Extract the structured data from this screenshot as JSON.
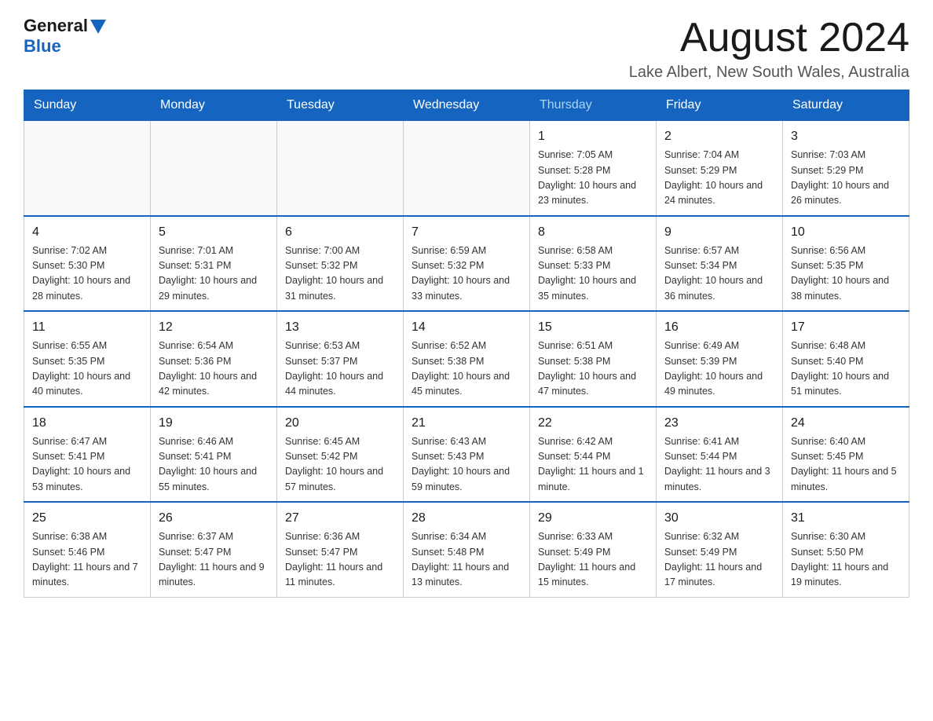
{
  "header": {
    "logo_general": "General",
    "logo_blue": "Blue",
    "month_year": "August 2024",
    "location": "Lake Albert, New South Wales, Australia"
  },
  "weekdays": [
    "Sunday",
    "Monday",
    "Tuesday",
    "Wednesday",
    "Thursday",
    "Friday",
    "Saturday"
  ],
  "weeks": [
    [
      {
        "day": "",
        "info": ""
      },
      {
        "day": "",
        "info": ""
      },
      {
        "day": "",
        "info": ""
      },
      {
        "day": "",
        "info": ""
      },
      {
        "day": "1",
        "info": "Sunrise: 7:05 AM\nSunset: 5:28 PM\nDaylight: 10 hours\nand 23 minutes."
      },
      {
        "day": "2",
        "info": "Sunrise: 7:04 AM\nSunset: 5:29 PM\nDaylight: 10 hours\nand 24 minutes."
      },
      {
        "day": "3",
        "info": "Sunrise: 7:03 AM\nSunset: 5:29 PM\nDaylight: 10 hours\nand 26 minutes."
      }
    ],
    [
      {
        "day": "4",
        "info": "Sunrise: 7:02 AM\nSunset: 5:30 PM\nDaylight: 10 hours\nand 28 minutes."
      },
      {
        "day": "5",
        "info": "Sunrise: 7:01 AM\nSunset: 5:31 PM\nDaylight: 10 hours\nand 29 minutes."
      },
      {
        "day": "6",
        "info": "Sunrise: 7:00 AM\nSunset: 5:32 PM\nDaylight: 10 hours\nand 31 minutes."
      },
      {
        "day": "7",
        "info": "Sunrise: 6:59 AM\nSunset: 5:32 PM\nDaylight: 10 hours\nand 33 minutes."
      },
      {
        "day": "8",
        "info": "Sunrise: 6:58 AM\nSunset: 5:33 PM\nDaylight: 10 hours\nand 35 minutes."
      },
      {
        "day": "9",
        "info": "Sunrise: 6:57 AM\nSunset: 5:34 PM\nDaylight: 10 hours\nand 36 minutes."
      },
      {
        "day": "10",
        "info": "Sunrise: 6:56 AM\nSunset: 5:35 PM\nDaylight: 10 hours\nand 38 minutes."
      }
    ],
    [
      {
        "day": "11",
        "info": "Sunrise: 6:55 AM\nSunset: 5:35 PM\nDaylight: 10 hours\nand 40 minutes."
      },
      {
        "day": "12",
        "info": "Sunrise: 6:54 AM\nSunset: 5:36 PM\nDaylight: 10 hours\nand 42 minutes."
      },
      {
        "day": "13",
        "info": "Sunrise: 6:53 AM\nSunset: 5:37 PM\nDaylight: 10 hours\nand 44 minutes."
      },
      {
        "day": "14",
        "info": "Sunrise: 6:52 AM\nSunset: 5:38 PM\nDaylight: 10 hours\nand 45 minutes."
      },
      {
        "day": "15",
        "info": "Sunrise: 6:51 AM\nSunset: 5:38 PM\nDaylight: 10 hours\nand 47 minutes."
      },
      {
        "day": "16",
        "info": "Sunrise: 6:49 AM\nSunset: 5:39 PM\nDaylight: 10 hours\nand 49 minutes."
      },
      {
        "day": "17",
        "info": "Sunrise: 6:48 AM\nSunset: 5:40 PM\nDaylight: 10 hours\nand 51 minutes."
      }
    ],
    [
      {
        "day": "18",
        "info": "Sunrise: 6:47 AM\nSunset: 5:41 PM\nDaylight: 10 hours\nand 53 minutes."
      },
      {
        "day": "19",
        "info": "Sunrise: 6:46 AM\nSunset: 5:41 PM\nDaylight: 10 hours\nand 55 minutes."
      },
      {
        "day": "20",
        "info": "Sunrise: 6:45 AM\nSunset: 5:42 PM\nDaylight: 10 hours\nand 57 minutes."
      },
      {
        "day": "21",
        "info": "Sunrise: 6:43 AM\nSunset: 5:43 PM\nDaylight: 10 hours\nand 59 minutes."
      },
      {
        "day": "22",
        "info": "Sunrise: 6:42 AM\nSunset: 5:44 PM\nDaylight: 11 hours\nand 1 minute."
      },
      {
        "day": "23",
        "info": "Sunrise: 6:41 AM\nSunset: 5:44 PM\nDaylight: 11 hours\nand 3 minutes."
      },
      {
        "day": "24",
        "info": "Sunrise: 6:40 AM\nSunset: 5:45 PM\nDaylight: 11 hours\nand 5 minutes."
      }
    ],
    [
      {
        "day": "25",
        "info": "Sunrise: 6:38 AM\nSunset: 5:46 PM\nDaylight: 11 hours\nand 7 minutes."
      },
      {
        "day": "26",
        "info": "Sunrise: 6:37 AM\nSunset: 5:47 PM\nDaylight: 11 hours\nand 9 minutes."
      },
      {
        "day": "27",
        "info": "Sunrise: 6:36 AM\nSunset: 5:47 PM\nDaylight: 11 hours\nand 11 minutes."
      },
      {
        "day": "28",
        "info": "Sunrise: 6:34 AM\nSunset: 5:48 PM\nDaylight: 11 hours\nand 13 minutes."
      },
      {
        "day": "29",
        "info": "Sunrise: 6:33 AM\nSunset: 5:49 PM\nDaylight: 11 hours\nand 15 minutes."
      },
      {
        "day": "30",
        "info": "Sunrise: 6:32 AM\nSunset: 5:49 PM\nDaylight: 11 hours\nand 17 minutes."
      },
      {
        "day": "31",
        "info": "Sunrise: 6:30 AM\nSunset: 5:50 PM\nDaylight: 11 hours\nand 19 minutes."
      }
    ]
  ]
}
